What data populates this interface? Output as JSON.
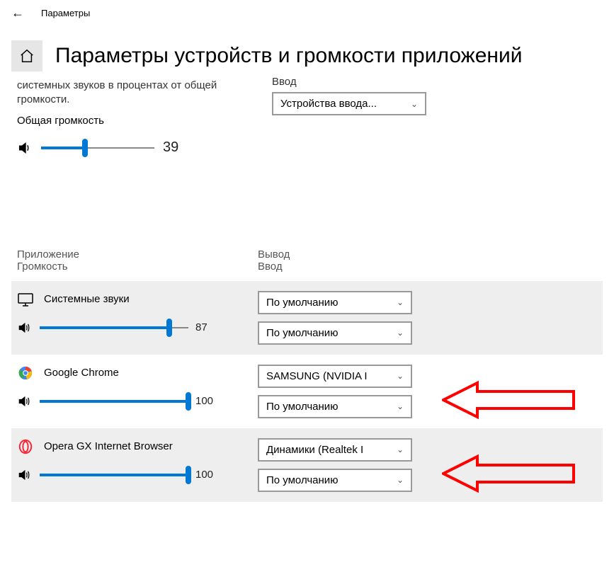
{
  "window_title": "Параметры",
  "page_title": "Параметры устройств и громкости приложений",
  "description": "системных звуков в процентах от общей громкости.",
  "master_label": "Общая громкость",
  "master_volume": 39,
  "input_section_label": "Ввод",
  "input_device_dropdown": "Устройства ввода...",
  "headers": {
    "left_line1": "Приложение",
    "left_line2": "Громкость",
    "right_line1": "Вывод",
    "right_line2": "Ввод"
  },
  "default_text": "По умолчанию",
  "apps": [
    {
      "name": "Системные звуки",
      "icon": "monitor",
      "volume": 87,
      "output": "По умолчанию",
      "input": "По умолчанию",
      "zebra": true,
      "annotated": false
    },
    {
      "name": "Google Chrome",
      "icon": "chrome",
      "volume": 100,
      "output": "SAMSUNG (NVIDIA I",
      "input": "По умолчанию",
      "zebra": false,
      "annotated": true
    },
    {
      "name": "Opera GX Internet Browser",
      "icon": "opera",
      "volume": 100,
      "output": "Динамики (Realtek I",
      "input": "По умолчанию",
      "zebra": true,
      "annotated": true
    }
  ]
}
